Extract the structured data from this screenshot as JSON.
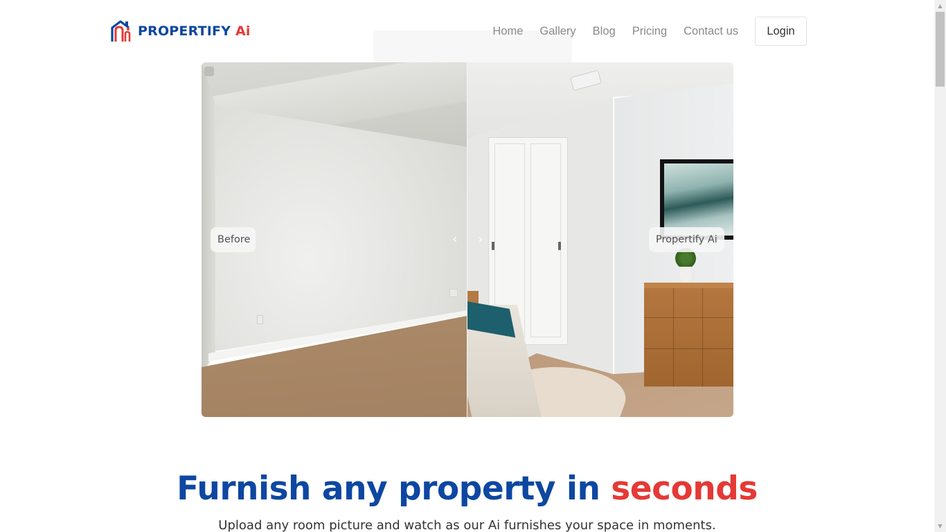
{
  "brand": {
    "name_main": "PROPERTIFY",
    "name_accent": "Ai",
    "primary_color": "#0d47a1",
    "accent_color": "#e53935",
    "logo_icon": "house-logo-icon"
  },
  "nav": {
    "items": [
      {
        "label": "Home"
      },
      {
        "label": "Gallery"
      },
      {
        "label": "Blog"
      },
      {
        "label": "Pricing"
      },
      {
        "label": "Contact us"
      }
    ],
    "login_label": "Login"
  },
  "toast": {
    "text": ""
  },
  "comparison": {
    "before_label": "Before",
    "after_label": "Propertify Ai",
    "left_arrow_icon": "chevron-left-icon",
    "right_arrow_icon": "chevron-right-icon",
    "left_arrow_glyph": "‹",
    "right_arrow_glyph": "›"
  },
  "hero": {
    "title_main": "Furnish any property in ",
    "title_accent": "seconds",
    "subtitle": "Upload any room picture and watch as our Ai furnishes your space in moments."
  },
  "scrollbar": {
    "up_glyph": "▲",
    "down_glyph": "▼"
  }
}
